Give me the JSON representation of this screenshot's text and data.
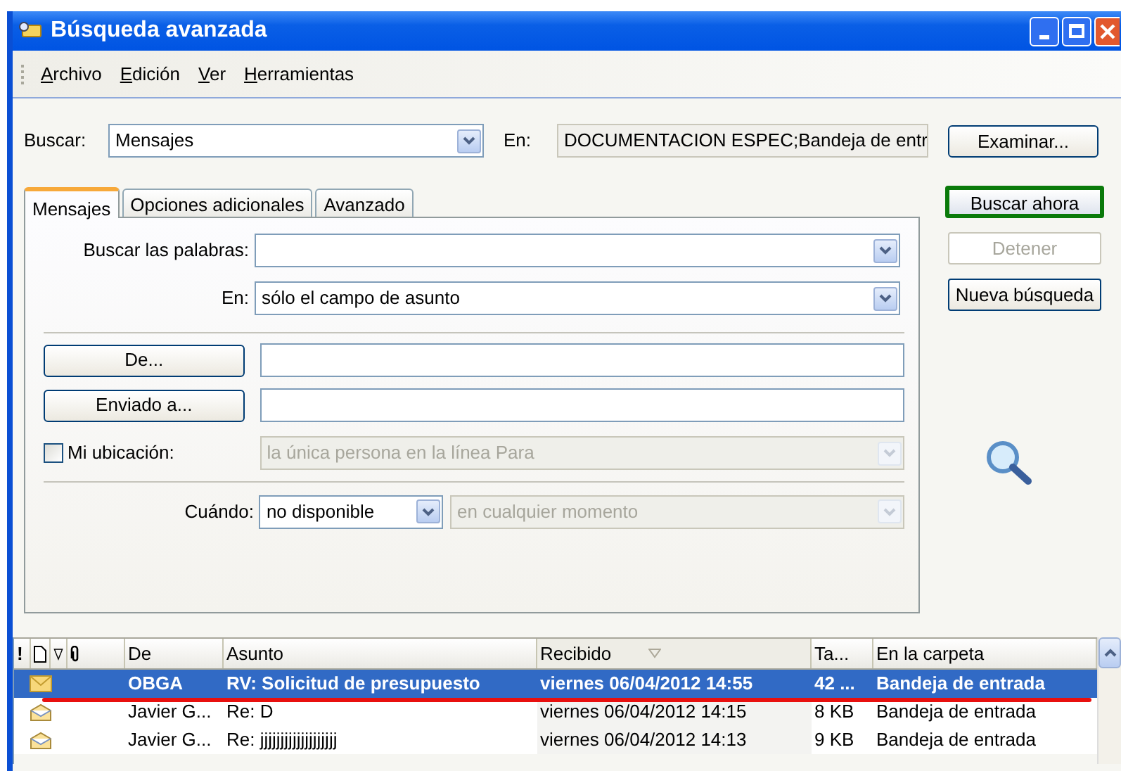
{
  "window": {
    "title": "Búsqueda avanzada"
  },
  "menu": [
    "Archivo",
    "Edición",
    "Ver",
    "Herramientas"
  ],
  "search": {
    "label": "Buscar:",
    "value": "Mensajes",
    "in_label": "En:",
    "in_value": "DOCUMENTACION ESPEC;Bandeja de entr",
    "browse": "Examinar..."
  },
  "actions": [
    {
      "label": "Buscar ahora",
      "highlighted": true,
      "disabled": false
    },
    {
      "label": "Detener",
      "highlighted": false,
      "disabled": true
    },
    {
      "label": "Nueva búsqueda",
      "highlighted": false,
      "disabled": false
    }
  ],
  "tabs": [
    {
      "label": "Mensajes",
      "selected": true
    },
    {
      "label": "Opciones adicionales",
      "selected": false
    },
    {
      "label": "Avanzado",
      "selected": false
    }
  ],
  "form": {
    "words": {
      "label": "Buscar las palabras:"
    },
    "in": {
      "label": "En:",
      "value": "sólo el campo de asunto"
    },
    "from": {
      "button": "De..."
    },
    "sent_to": {
      "button": "Enviado a..."
    },
    "location": {
      "label": "Mi ubicación:",
      "checked": false,
      "value": "la única persona en la línea Para",
      "disabled": true
    },
    "when": {
      "label": "Cuándo:",
      "value": "no disponible",
      "range": "en cualquier momento",
      "range_disabled": true
    }
  },
  "results": {
    "columns": [
      {
        "kind": "text",
        "label": "!",
        "sorted": false
      },
      {
        "kind": "page",
        "sorted": false
      },
      {
        "kind": "flag",
        "sorted": false
      },
      {
        "kind": "clip",
        "sorted": false
      },
      {
        "kind": "text",
        "label": "De",
        "sorted": false
      },
      {
        "kind": "text",
        "label": "Asunto",
        "sorted": false
      },
      {
        "kind": "text",
        "label": "Recibido",
        "sorted": true
      },
      {
        "kind": "text",
        "label": "Ta...",
        "sorted": false
      },
      {
        "kind": "text",
        "label": "En la carpeta",
        "sorted": false
      }
    ],
    "rows": [
      {
        "unread": true,
        "selected": true,
        "underlined": true,
        "from": "OBGA",
        "subject": "RV: Solicitud de presupuesto",
        "received": "viernes 06/04/2012 14:55",
        "size": "42 ...",
        "folder": "Bandeja de entrada"
      },
      {
        "unread": false,
        "selected": false,
        "underlined": false,
        "from": "Javier G...",
        "subject": "Re: D",
        "received": "viernes 06/04/2012 14:15",
        "size": "8 KB",
        "folder": "Bandeja de entrada"
      },
      {
        "unread": false,
        "selected": false,
        "underlined": false,
        "from": "Javier G...",
        "subject": "Re: jjjjjjjjjjjjjjjjjjj",
        "received": "viernes 06/04/2012 14:13",
        "size": "9 KB",
        "folder": "Bandeja de entrada"
      }
    ]
  }
}
